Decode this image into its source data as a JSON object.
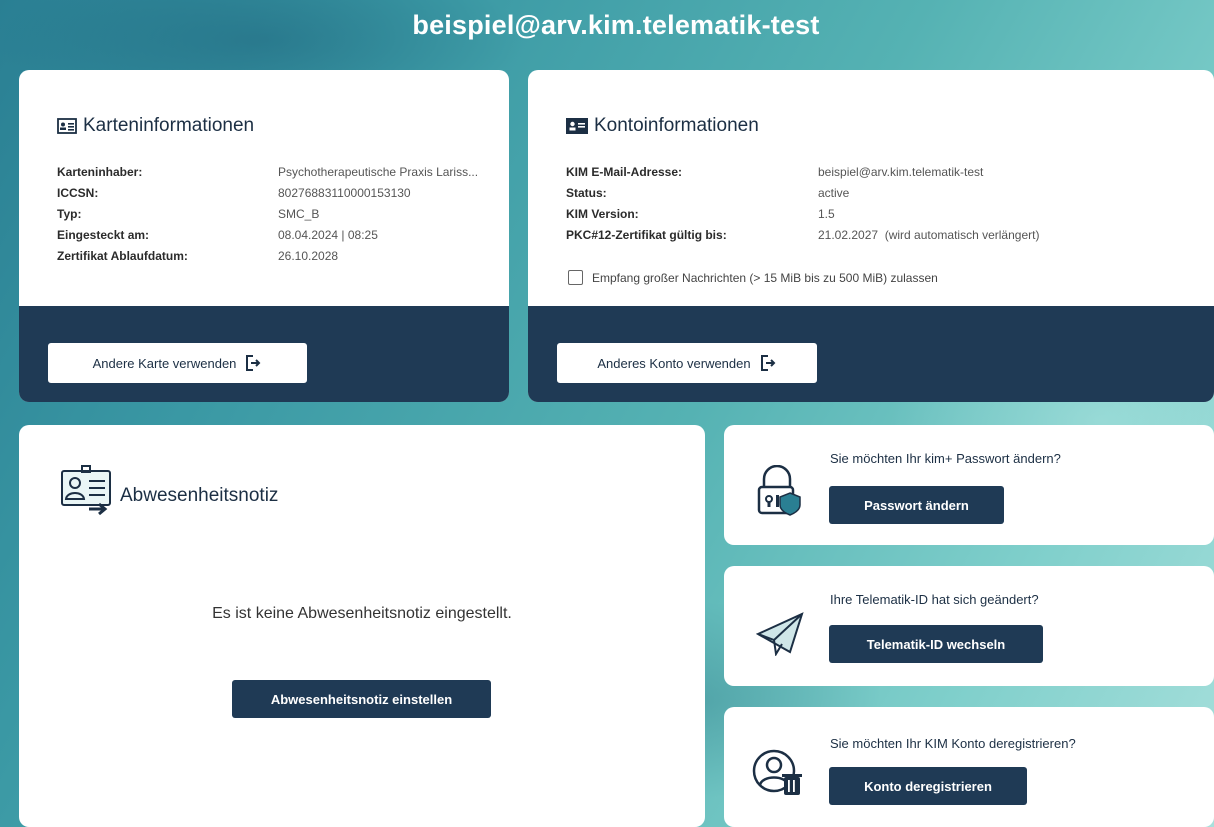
{
  "header": {
    "title": "beispiel@arv.kim.telematik-test"
  },
  "card_info": {
    "heading": "Karteninformationen",
    "rows": [
      {
        "label": "Karteninhaber:",
        "value": "Psychotherapeutische Praxis Lariss..."
      },
      {
        "label": "ICCSN:",
        "value": "80276883110000153130"
      },
      {
        "label": "Typ:",
        "value": "SMC_B"
      },
      {
        "label": "Eingesteckt am:",
        "value": "08.04.2024 | 08:25"
      },
      {
        "label": "Zertifikat Ablaufdatum:",
        "value": "26.10.2028"
      }
    ],
    "button_label": "Andere Karte verwenden"
  },
  "account_info": {
    "heading": "Kontoinformationen",
    "rows": [
      {
        "label": "KIM E-Mail-Adresse:",
        "value": "beispiel@arv.kim.telematik-test"
      },
      {
        "label": "Status:",
        "value": "active"
      },
      {
        "label": "KIM Version:",
        "value": "1.5"
      },
      {
        "label": "PKC#12-Zertifikat gültig bis:",
        "value": "21.02.2027  (wird automatisch verlängert)"
      }
    ],
    "checkbox_label": "Empfang großer Nachrichten (> 15 MiB bis zu 500 MiB) zulassen",
    "checkbox_checked": false,
    "button_label": "Anderes Konto verwenden"
  },
  "absence": {
    "heading": "Abwesenheitsnotiz",
    "empty_text": "Es ist keine Abwesenheitsnotiz eingestellt.",
    "button_label": "Abwesenheitsnotiz einstellen"
  },
  "password": {
    "question": "Sie möchten Ihr kim+ Passwort ändern?",
    "button_label": "Passwort ändern"
  },
  "telematik": {
    "question": "Ihre Telematik-ID hat sich geändert?",
    "button_label": "Telematik-ID wechseln"
  },
  "deregister": {
    "question": "Sie möchten Ihr KIM Konto deregistrieren?",
    "button_label": "Konto deregistrieren"
  },
  "colors": {
    "navy": "#1f3a55",
    "teal": "#3a98a4"
  }
}
